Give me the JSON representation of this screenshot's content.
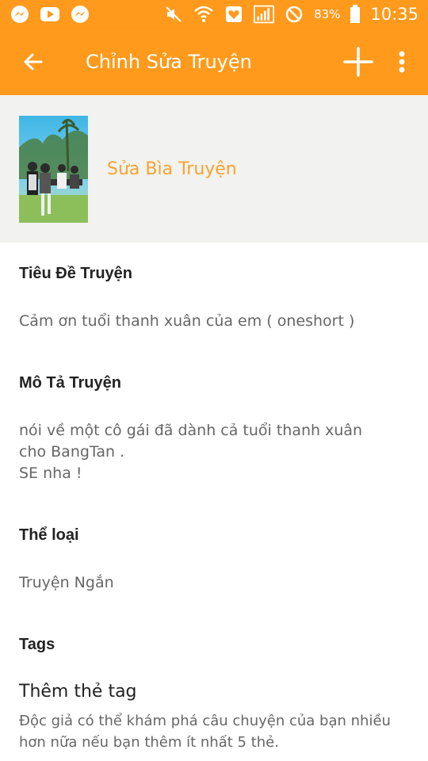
{
  "status_bar": {
    "icons_left": [
      "messenger-icon",
      "youtube-icon",
      "messenger-icon"
    ],
    "icons_right": [
      "mute-icon",
      "wifi-icon",
      "heart-icon",
      "signal-icon",
      "no-disturb-icon",
      "battery-icon"
    ],
    "battery": "83%",
    "time": "10:35"
  },
  "app_bar": {
    "title": "Chỉnh Sửa Truyện"
  },
  "cover": {
    "label": "Sửa Bìa Truyện"
  },
  "fields": {
    "title": {
      "heading": "Tiêu Đề Truyện",
      "value": "Cảm ơn tuổi thanh xuân của em ( oneshort )"
    },
    "description": {
      "heading": "Mô Tả Truyện",
      "lines": [
        "nói về một cô gái đã dành cả tuổi thanh xuân",
        "cho BangTan .",
        "SE nha !"
      ]
    },
    "genre": {
      "heading": "Thể loại",
      "value": "Truyện Ngắn"
    },
    "tags": {
      "heading": "Tags",
      "add_title": "Thêm thẻ tag",
      "add_desc": "Độc giả có thể khám phá câu chuyện của bạn nhiều hơn nữa nếu bạn thêm ít nhất 5 thẻ."
    }
  },
  "colors": {
    "primary": "#ff9a1c",
    "accent_text": "#f5a431",
    "cover_bg": "#f2f2f0"
  }
}
